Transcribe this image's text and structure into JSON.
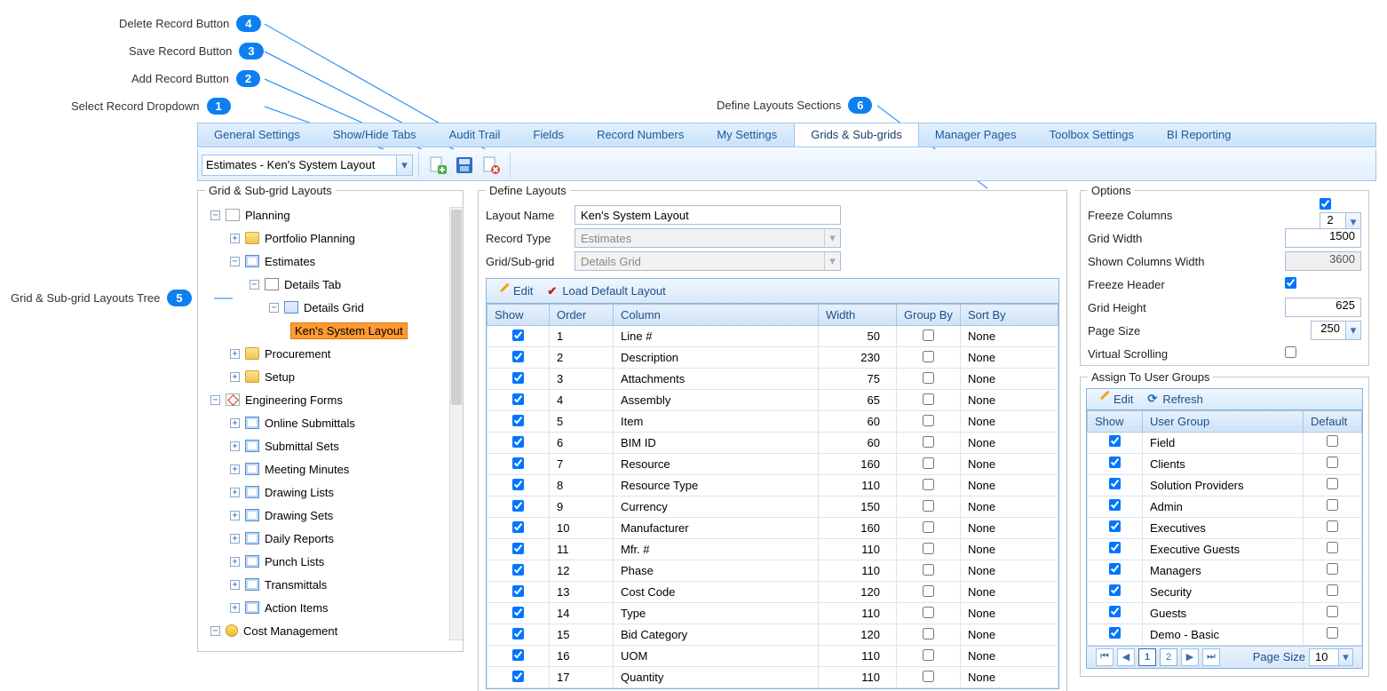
{
  "callouts": {
    "c1": "Select Record Dropdown",
    "c2": "Add Record Button",
    "c3": "Save Record Button",
    "c4": "Delete Record Button",
    "c5": "Grid & Sub-grid Layouts Tree",
    "c6": "Define Layouts Sections"
  },
  "tabs": [
    "General Settings",
    "Show/Hide Tabs",
    "Audit Trail",
    "Fields",
    "Record Numbers",
    "My Settings",
    "Grids & Sub-grids",
    "Manager Pages",
    "Toolbox Settings",
    "BI Reporting"
  ],
  "activeTab": "Grids & Sub-grids",
  "recordSelect": "Estimates -  Ken's System Layout",
  "panels": {
    "tree": "Grid & Sub-grid Layouts",
    "define": "Define Layouts",
    "options": "Options",
    "assign": "Assign To User Groups"
  },
  "tree": {
    "planning": "Planning",
    "portfolio": "Portfolio Planning",
    "estimates": "Estimates",
    "detailsTab": "Details Tab",
    "detailsGrid": "Details Grid",
    "kens": "Ken's System Layout",
    "procurement": "Procurement",
    "setup": "Setup",
    "eng": "Engineering Forms",
    "onlineSub": "Online Submittals",
    "submittalSets": "Submittal Sets",
    "meeting": "Meeting Minutes",
    "drawingLists": "Drawing Lists",
    "drawingSets": "Drawing Sets",
    "dailyReports": "Daily Reports",
    "punchLists": "Punch Lists",
    "transmittals": "Transmittals",
    "actionItems": "Action Items",
    "costMgmt": "Cost Management"
  },
  "form": {
    "layoutNameLbl": "Layout Name",
    "layoutName": "Ken's System Layout",
    "recordTypeLbl": "Record Type",
    "recordType": "Estimates",
    "gridSubLbl": "Grid/Sub-grid",
    "gridSub": "Details Grid"
  },
  "columnsGrid": {
    "editBtn": "Edit",
    "loadDefault": "Load Default Layout",
    "headers": {
      "show": "Show",
      "order": "Order",
      "column": "Column",
      "width": "Width",
      "groupBy": "Group By",
      "sortBy": "Sort By"
    },
    "rows": [
      {
        "show": true,
        "order": "1",
        "column": "Line #",
        "width": "50",
        "group": false,
        "sort": "None"
      },
      {
        "show": true,
        "order": "2",
        "column": "Description",
        "width": "230",
        "group": false,
        "sort": "None"
      },
      {
        "show": true,
        "order": "3",
        "column": "Attachments",
        "width": "75",
        "group": false,
        "sort": "None"
      },
      {
        "show": true,
        "order": "4",
        "column": "Assembly",
        "width": "65",
        "group": false,
        "sort": "None"
      },
      {
        "show": true,
        "order": "5",
        "column": "Item",
        "width": "60",
        "group": false,
        "sort": "None"
      },
      {
        "show": true,
        "order": "6",
        "column": "BIM ID",
        "width": "60",
        "group": false,
        "sort": "None"
      },
      {
        "show": true,
        "order": "7",
        "column": "Resource",
        "width": "160",
        "group": false,
        "sort": "None"
      },
      {
        "show": true,
        "order": "8",
        "column": "Resource Type",
        "width": "110",
        "group": false,
        "sort": "None"
      },
      {
        "show": true,
        "order": "9",
        "column": "Currency",
        "width": "150",
        "group": false,
        "sort": "None"
      },
      {
        "show": true,
        "order": "10",
        "column": "Manufacturer",
        "width": "160",
        "group": false,
        "sort": "None"
      },
      {
        "show": true,
        "order": "11",
        "column": "Mfr. #",
        "width": "110",
        "group": false,
        "sort": "None"
      },
      {
        "show": true,
        "order": "12",
        "column": "Phase",
        "width": "110",
        "group": false,
        "sort": "None"
      },
      {
        "show": true,
        "order": "13",
        "column": "Cost Code",
        "width": "120",
        "group": false,
        "sort": "None"
      },
      {
        "show": true,
        "order": "14",
        "column": "Type",
        "width": "110",
        "group": false,
        "sort": "None"
      },
      {
        "show": true,
        "order": "15",
        "column": "Bid Category",
        "width": "120",
        "group": false,
        "sort": "None"
      },
      {
        "show": true,
        "order": "16",
        "column": "UOM",
        "width": "110",
        "group": false,
        "sort": "None"
      },
      {
        "show": true,
        "order": "17",
        "column": "Quantity",
        "width": "110",
        "group": false,
        "sort": "None"
      }
    ]
  },
  "options": {
    "freezeColsLbl": "Freeze Columns",
    "freezeColsChk": true,
    "freezeColsVal": "2",
    "gridWidthLbl": "Grid Width",
    "gridWidth": "1500",
    "shownWidthLbl": "Shown Columns Width",
    "shownWidth": "3600",
    "freezeHeaderLbl": "Freeze Header",
    "freezeHeader": true,
    "gridHeightLbl": "Grid Height",
    "gridHeight": "625",
    "pageSizeLbl": "Page Size",
    "pageSize": "250",
    "virtualLbl": "Virtual Scrolling",
    "virtual": false
  },
  "assign": {
    "editBtn": "Edit",
    "refreshBtn": "Refresh",
    "headers": {
      "show": "Show",
      "ug": "User Group",
      "def": "Default"
    },
    "rows": [
      {
        "show": true,
        "name": "Field",
        "def": false
      },
      {
        "show": true,
        "name": "Clients",
        "def": false
      },
      {
        "show": true,
        "name": "Solution Providers",
        "def": false
      },
      {
        "show": true,
        "name": "Admin",
        "def": false
      },
      {
        "show": true,
        "name": "Executives",
        "def": false
      },
      {
        "show": true,
        "name": "Executive Guests",
        "def": false
      },
      {
        "show": true,
        "name": "Managers",
        "def": false
      },
      {
        "show": true,
        "name": "Security",
        "def": false
      },
      {
        "show": true,
        "name": "Guests",
        "def": false
      },
      {
        "show": true,
        "name": "Demo - Basic",
        "def": false
      }
    ],
    "pager": {
      "pages": [
        "1",
        "2"
      ],
      "active": "1",
      "pageSizeLbl": "Page Size",
      "pageSize": "10"
    }
  }
}
